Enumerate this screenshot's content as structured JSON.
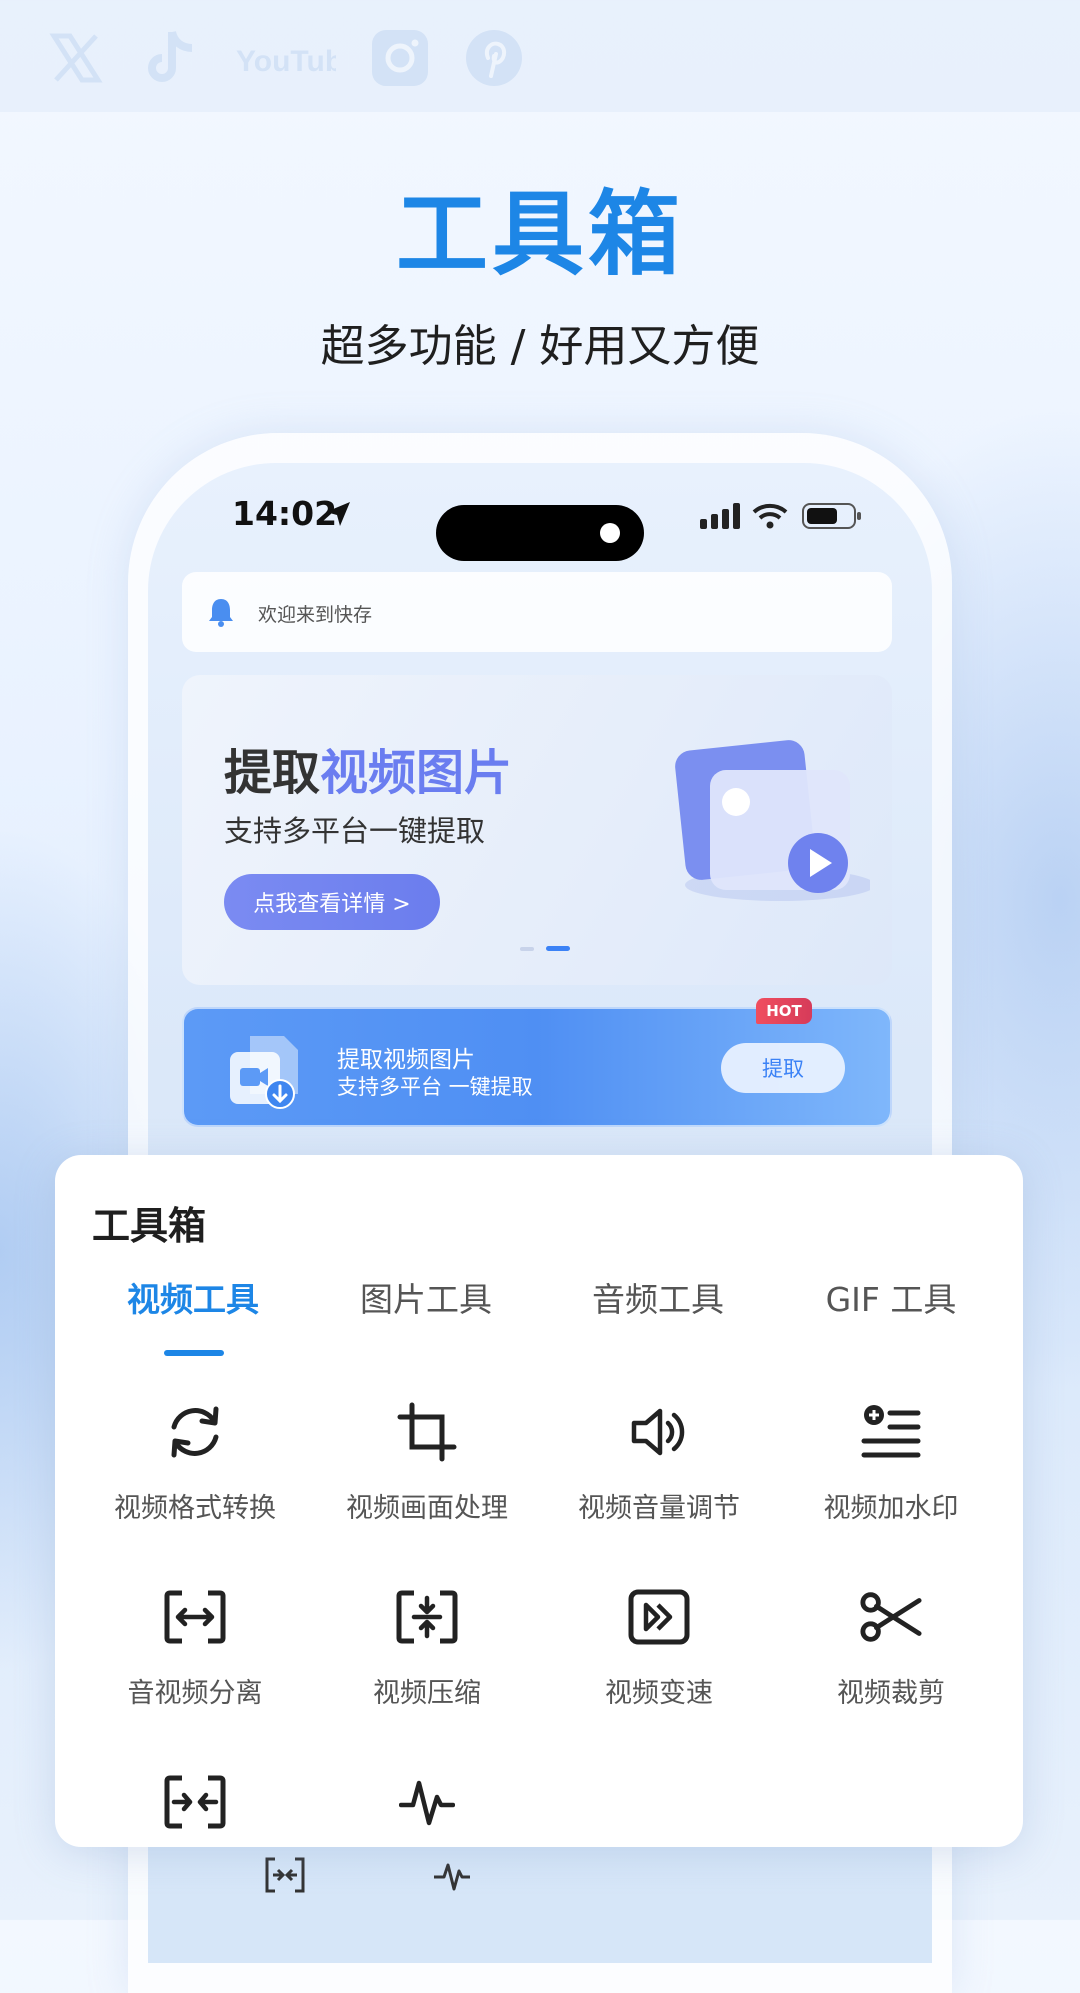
{
  "social_icons": [
    "x-icon",
    "tiktok-icon",
    "youtube-icon",
    "instagram-icon",
    "pinterest-icon"
  ],
  "social_youtube_text": "YouTube",
  "page_title": "工具箱",
  "page_subtitle": "超多功能 / 好用又方便",
  "phone": {
    "status_time": "14:02",
    "notice": "欢迎来到快存",
    "banner": {
      "title_part1": "提取",
      "title_part2": "视频图片",
      "subtitle": "支持多平台一键提取",
      "button": "点我查看详情 >"
    },
    "promo": {
      "badge": "HOT",
      "title": "提取视频图片",
      "subtitle": "支持多平台 一键提取",
      "button": "提取"
    }
  },
  "toolbox": {
    "title": "工具箱",
    "tabs": [
      {
        "label": "视频工具",
        "active": true
      },
      {
        "label": "图片工具",
        "active": false
      },
      {
        "label": "音频工具",
        "active": false
      },
      {
        "label": "GIF 工具",
        "active": false
      }
    ],
    "tools": [
      {
        "label": "视频格式转换",
        "icon": "convert-icon"
      },
      {
        "label": "视频画面处理",
        "icon": "crop-icon"
      },
      {
        "label": "视频音量调节",
        "icon": "volume-icon"
      },
      {
        "label": "视频加水印",
        "icon": "watermark-icon"
      },
      {
        "label": "音视频分离",
        "icon": "separate-icon"
      },
      {
        "label": "视频压缩",
        "icon": "compress-icon"
      },
      {
        "label": "视频变速",
        "icon": "speed-icon"
      },
      {
        "label": "视频裁剪",
        "icon": "scissors-icon"
      },
      {
        "label": "",
        "icon": "merge-icon"
      },
      {
        "label": "",
        "icon": "waveform-icon"
      }
    ]
  },
  "colors": {
    "accent": "#1d86e6",
    "banner_highlight": "#6a7df0",
    "hot": "#e2455c"
  }
}
